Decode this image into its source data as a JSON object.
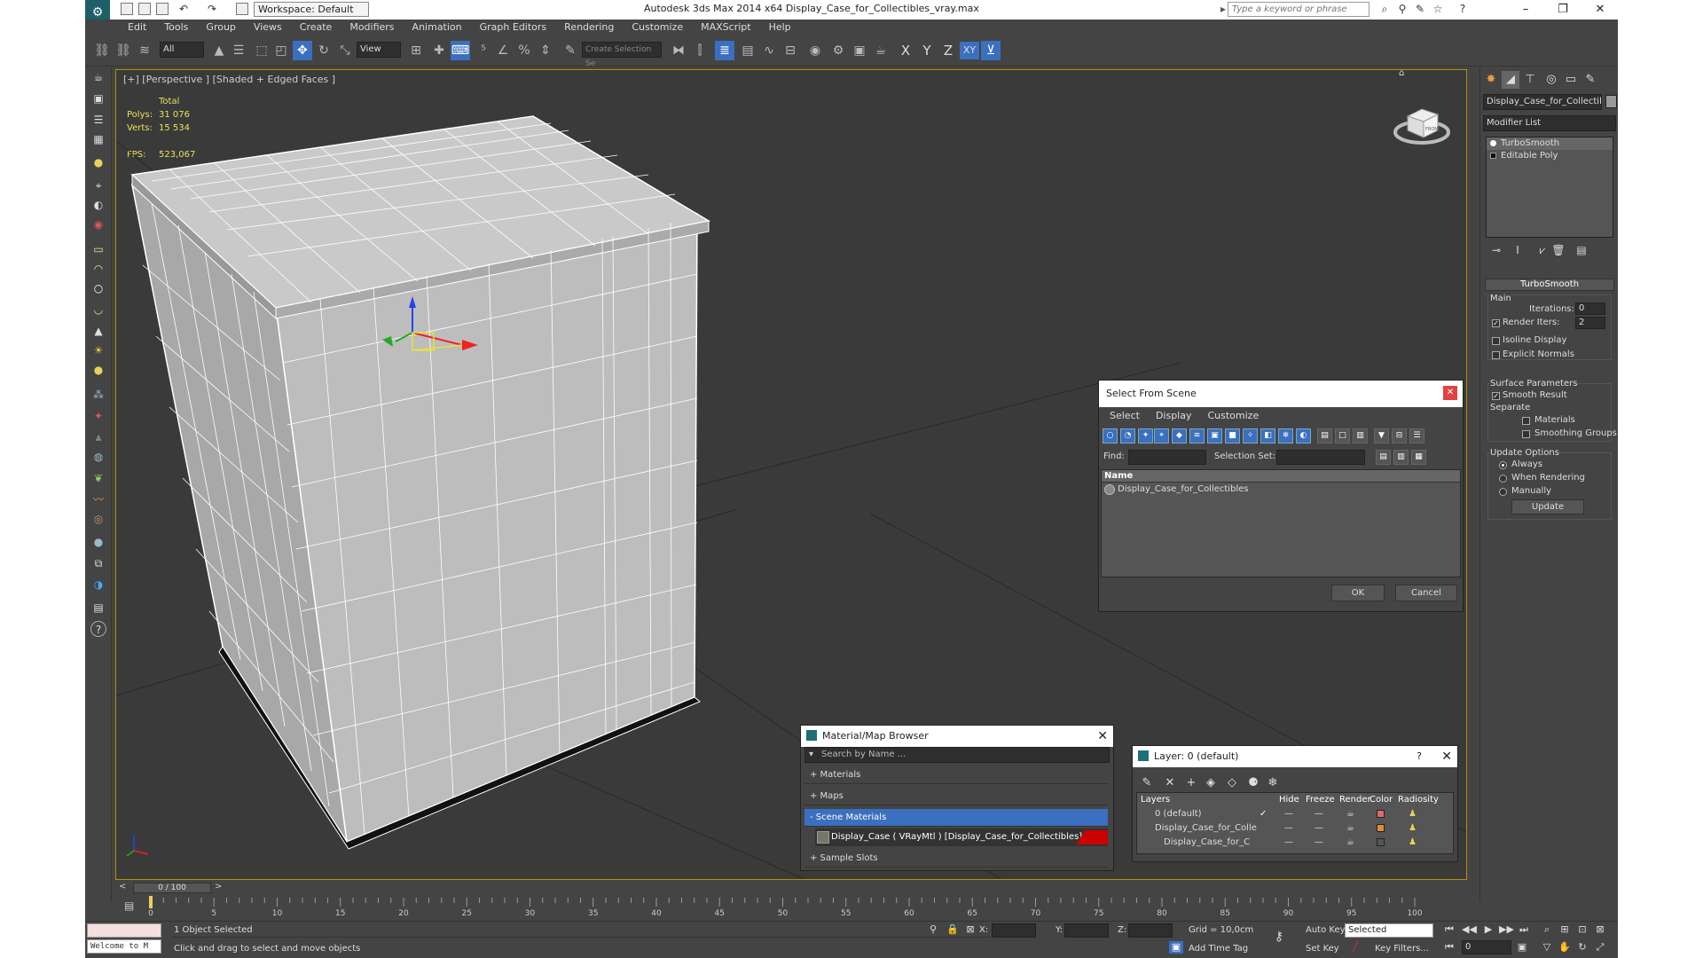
{
  "titlebar": {
    "workspace": "Workspace: Default",
    "title": "Autodesk 3ds Max  2014 x64     Display_Case_for_Collectibles_vray.max",
    "search_placeholder": "Type a keyword or phrase"
  },
  "menu": [
    "Edit",
    "Tools",
    "Group",
    "Views",
    "Create",
    "Modifiers",
    "Animation",
    "Graph Editors",
    "Rendering",
    "Customize",
    "MAXScript",
    "Help"
  ],
  "toolbar": {
    "selection_filter": "All",
    "ref_coord": "View",
    "named_selection": "Create Selection Se",
    "axes": [
      "X",
      "Y",
      "Z",
      "XY"
    ]
  },
  "viewport": {
    "label": "[+] [Perspective ] [Shaded + Edged Faces ]",
    "stats": {
      "total": "Total",
      "polys_label": "Polys:",
      "polys": "31 076",
      "verts_label": "Verts:",
      "verts": "15 534",
      "fps_label": "FPS:",
      "fps": "523,067"
    },
    "navcube_label": "FRONT"
  },
  "select_from_scene": {
    "title": "Select From Scene",
    "menu": [
      "Select",
      "Display",
      "Customize"
    ],
    "find_label": "Find:",
    "selection_set_label": "Selection Set:",
    "column_name": "Name",
    "items": [
      "Display_Case_for_Collectibles"
    ],
    "ok": "OK",
    "cancel": "Cancel"
  },
  "material_browser": {
    "title": "Material/Map Browser",
    "search_placeholder": "Search by Name ...",
    "sections": [
      "+ Materials",
      "+ Maps",
      "- Scene Materials",
      "+ Sample Slots"
    ],
    "scene_material": "Display_Case ( VRayMtl ) [Display_Case_for_Collectibles]"
  },
  "layer_manager": {
    "title": "Layer: 0 (default)",
    "columns": [
      "Layers",
      "Hide",
      "Freeze",
      "Render",
      "Color",
      "Radiosity"
    ],
    "rows": [
      {
        "name": "0 (default)",
        "color": "#e26a6a"
      },
      {
        "name": "Display_Case_for_Colle",
        "color": "#e08a3c"
      },
      {
        "name": "Display_Case_for_C",
        "color": "#555555"
      }
    ]
  },
  "command_panel": {
    "object_name": "Display_Case_for_Collectibles",
    "modifier_list": "Modifier List",
    "stack": [
      "TurboSmooth",
      "Editable Poly"
    ],
    "rollout_title": "TurboSmooth",
    "main_group": "Main",
    "iterations_label": "Iterations:",
    "iterations": "0",
    "render_iters_label": "Render Iters:",
    "render_iters": "2",
    "isoline_display": "Isoline Display",
    "explicit_normals": "Explicit Normals",
    "surface_params": "Surface Parameters",
    "smooth_result": "Smooth Result",
    "separate": "Separate",
    "materials": "Materials",
    "smoothing_groups": "Smoothing Groups",
    "update_options": "Update Options",
    "always": "Always",
    "when_rendering": "When Rendering",
    "manually": "Manually",
    "update_btn": "Update"
  },
  "timeline": {
    "frame": "0 / 100",
    "ticks": [
      "0",
      "5",
      "10",
      "15",
      "20",
      "25",
      "30",
      "35",
      "40",
      "45",
      "50",
      "55",
      "60",
      "65",
      "70",
      "75",
      "80",
      "85",
      "90",
      "95",
      "100"
    ]
  },
  "status": {
    "maxscript": "Welcome to M",
    "selected": "1 Object Selected",
    "prompt": "Click and drag to select and move objects",
    "x_label": "X:",
    "y_label": "Y:",
    "z_label": "Z:",
    "grid": "Grid = 10,0cm",
    "add_time_tag": "Add Time Tag",
    "auto_key": "Auto Key",
    "set_key": "Set Key",
    "key_mode": "Selected",
    "key_filters": "Key Filters...",
    "frame_field": "0"
  },
  "colors": {
    "accent": "#3b6fbf",
    "viewport_border": "#b89000",
    "stats_text": "#e9e05a"
  }
}
